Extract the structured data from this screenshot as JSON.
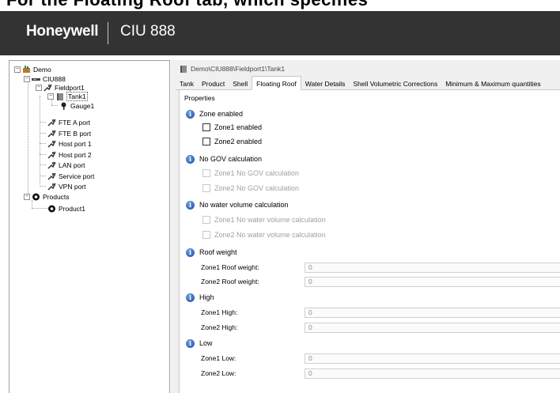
{
  "top_caption": "For the Floating Roof tab, which specifies",
  "header": {
    "brand": "Honeywell",
    "product": "CIU 888"
  },
  "tree": {
    "root": "Demo",
    "ciu": "CIU888",
    "fieldport": "Fieldport1",
    "tank": "Tank1",
    "gauge": "Gauge1",
    "ports": [
      "FTE A port",
      "FTE B port",
      "Host port 1",
      "Host port 2",
      "LAN port",
      "Service port",
      "VPN port"
    ],
    "products": "Products",
    "product1": "Product1"
  },
  "path": "Demo\\CIU888\\Fieldport1\\Tank1",
  "tabs": [
    "Tank",
    "Product",
    "Shell",
    "Floating Roof",
    "Water Details",
    "Shell Volumetric Corrections",
    "Minimum & Maximum quantities"
  ],
  "active_tab": "Floating Roof",
  "properties": {
    "title": "Properties",
    "zone_enabled": {
      "heading": "Zone enabled",
      "zone1": "Zone1 enabled",
      "zone2": "Zone2 enabled"
    },
    "no_gov": {
      "heading": "No GOV calculation",
      "zone1": "Zone1 No GOV calculation",
      "zone2": "Zone2 No GOV calculation"
    },
    "no_water": {
      "heading": "No water volume  calculation",
      "zone1": "Zone1 No water volume  calculation",
      "zone2": "Zone2 No water volume  calculation"
    },
    "roof_weight": {
      "heading": "Roof weight",
      "zone1_label": "Zone1 Roof weight:",
      "zone1_value": "0",
      "zone2_label": "Zone2 Roof weight:",
      "zone2_value": "0"
    },
    "high": {
      "heading": "High",
      "zone1_label": "Zone1 High:",
      "zone1_value": "0",
      "zone2_label": "Zone2 High:",
      "zone2_value": "0"
    },
    "low": {
      "heading": "Low",
      "zone1_label": "Zone1 Low:",
      "zone1_value": "0",
      "zone2_label": "Zone2 Low:",
      "zone2_value": "0"
    }
  },
  "colors": {
    "header_bg": "#333333",
    "info_blue": "#1d4fa3",
    "panel_bg": "#f0f0f0"
  }
}
